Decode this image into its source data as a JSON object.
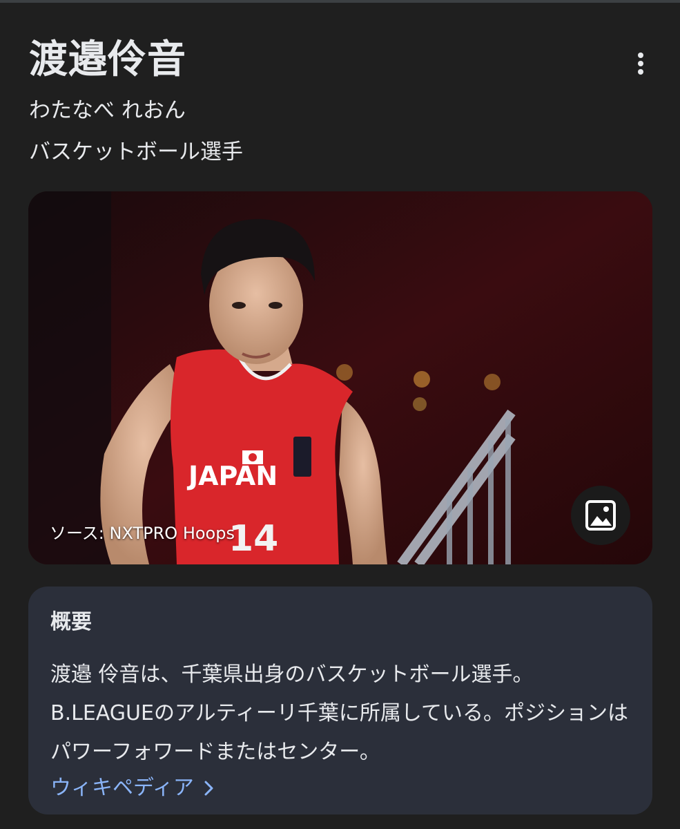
{
  "entity": {
    "name": "渡邉伶音",
    "reading": "わたなべ れおん",
    "occupation": "バスケットボール選手"
  },
  "image": {
    "source_caption": "ソース: NXTPRO Hoops",
    "jersey_text": "JAPAN",
    "jersey_number": "14"
  },
  "summary": {
    "heading": "概要",
    "text": "渡邉 伶音は、千葉県出身のバスケットボール選手。B.LEAGUEのアルティーリ千葉に所属している。ポジションはパワーフォワードまたはセンター。",
    "link_label": "ウィキペディア"
  },
  "icons": {
    "menu": "more-vert-icon",
    "gallery": "image-icon",
    "link_arrow": "chevron-right-icon"
  },
  "colors": {
    "background": "#1f1f1f",
    "card": "#2b2f3a",
    "link": "#8ab4f8",
    "jersey": "#d9262b"
  }
}
